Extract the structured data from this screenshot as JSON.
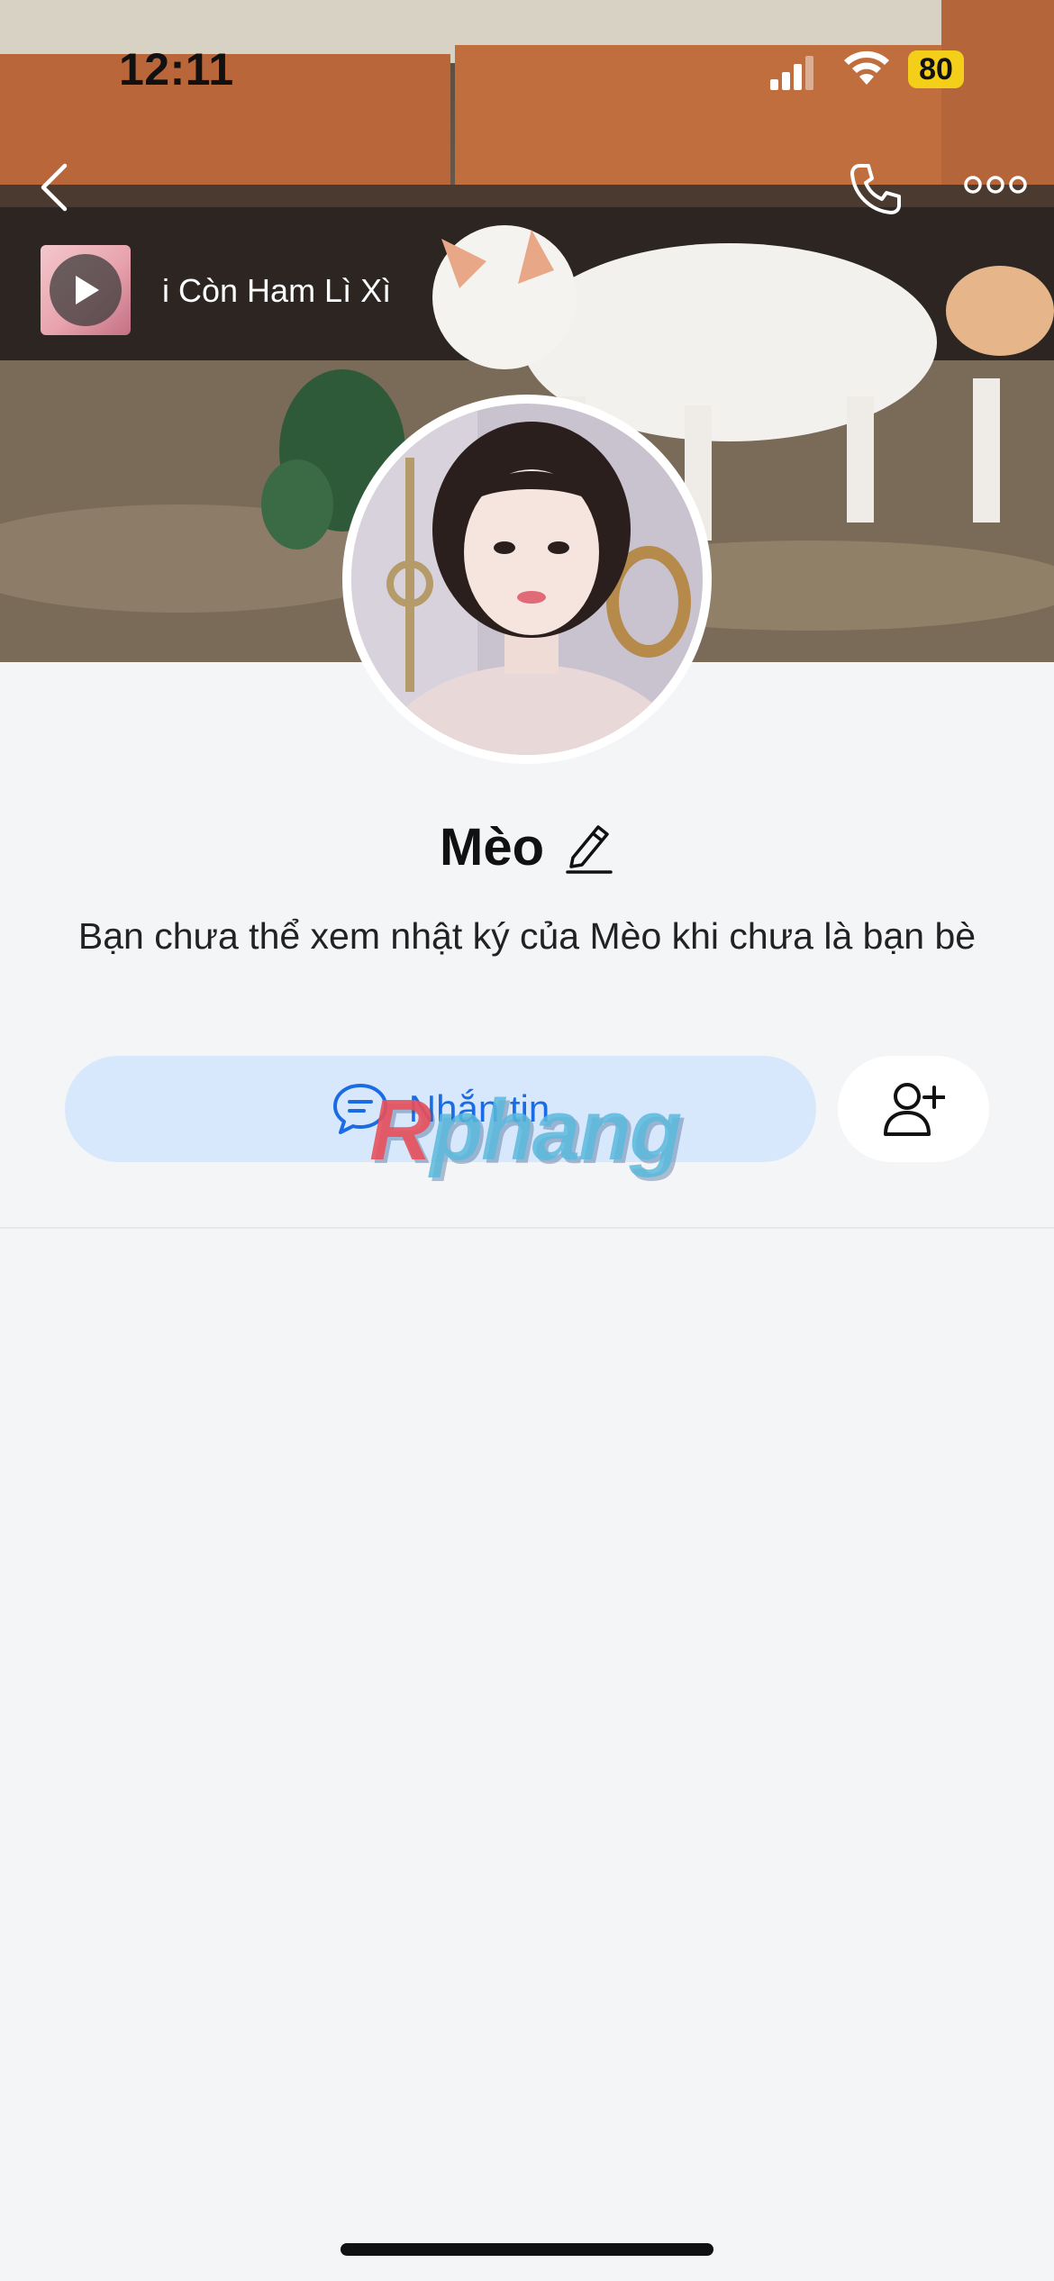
{
  "status_bar": {
    "time": "12:11",
    "battery": "80",
    "battery_color": "#f4cf1a"
  },
  "nav": {
    "back_icon": "chevron-left-icon",
    "call_icon": "phone-icon",
    "more_icon": "more-dots-icon"
  },
  "music": {
    "title": "i Còn Ham Lì Xì",
    "play_icon": "play-icon"
  },
  "profile": {
    "name": "Mèo",
    "edit_icon": "pencil-icon",
    "description": "Bạn chưa thể xem nhật ký của Mèo khi chưa là bạn bè"
  },
  "actions": {
    "message_label": "Nhắn tin",
    "message_icon": "chat-bubble-icon",
    "add_friend_icon": "add-friend-icon",
    "accent_color": "#1a6be4"
  },
  "watermark": {
    "first": "R",
    "rest": "phang"
  }
}
